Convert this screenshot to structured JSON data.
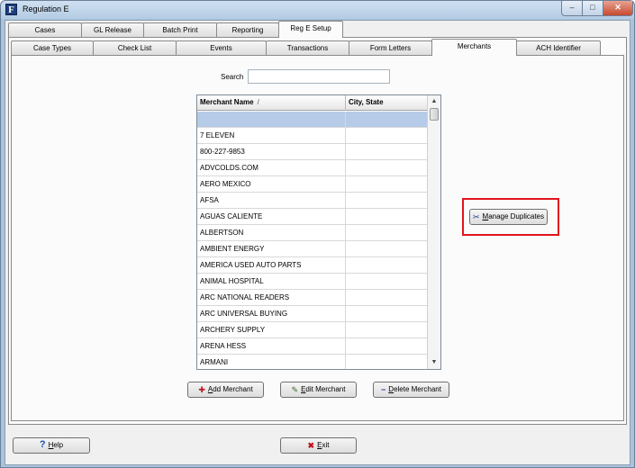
{
  "window": {
    "title": "Regulation E",
    "app_icon_glyph": "F",
    "controls": {
      "minimize": "–",
      "maximize": "□",
      "close": "✕"
    }
  },
  "main_tabs": [
    {
      "label": "Cases",
      "active": false
    },
    {
      "label": "GL Release",
      "active": false
    },
    {
      "label": "Batch Print",
      "active": false
    },
    {
      "label": "Reporting",
      "active": false
    },
    {
      "label": "Reg E Setup",
      "active": true
    }
  ],
  "sub_tabs": [
    {
      "label": "Case Types",
      "active": false
    },
    {
      "label": "Check List",
      "active": false
    },
    {
      "label": "Events",
      "active": false
    },
    {
      "label": "Transactions",
      "active": false
    },
    {
      "label": "Form Letters",
      "active": false
    },
    {
      "label": "Merchants",
      "active": true
    },
    {
      "label": "ACH Identifier",
      "active": false
    }
  ],
  "search": {
    "label": "Search",
    "value": ""
  },
  "grid": {
    "columns": [
      "Merchant Name",
      "City, State"
    ],
    "sort_indicator": "/",
    "rows": [
      {
        "name": "",
        "city": "",
        "selected": true
      },
      {
        "name": "7 ELEVEN",
        "city": ""
      },
      {
        "name": "800-227-9853",
        "city": ""
      },
      {
        "name": "ADVCOLDS.COM",
        "city": ""
      },
      {
        "name": "AERO MEXICO",
        "city": ""
      },
      {
        "name": "AFSA",
        "city": ""
      },
      {
        "name": "AGUAS CALIENTE",
        "city": ""
      },
      {
        "name": "ALBERTSON",
        "city": ""
      },
      {
        "name": "AMBIENT ENERGY",
        "city": ""
      },
      {
        "name": "AMERICA USED AUTO PARTS",
        "city": ""
      },
      {
        "name": "ANIMAL HOSPITAL",
        "city": ""
      },
      {
        "name": "ARC NATIONAL READERS",
        "city": ""
      },
      {
        "name": "ARC UNIVERSAL BUYING",
        "city": ""
      },
      {
        "name": "ARCHERY SUPPLY",
        "city": ""
      },
      {
        "name": "ARENA HESS",
        "city": ""
      },
      {
        "name": "ARMANI",
        "city": ""
      }
    ]
  },
  "buttons": {
    "manage_duplicates": {
      "mnemonic": "M",
      "rest": "anage Duplicates",
      "icon": "✂"
    },
    "add_merchant": {
      "mnemonic": "A",
      "rest": "dd Merchant",
      "icon": "✚"
    },
    "edit_merchant": {
      "mnemonic": "E",
      "rest": "dit Merchant",
      "icon": "✎"
    },
    "delete_merchant": {
      "mnemonic": "D",
      "rest": "elete Merchant",
      "icon": "−"
    },
    "help": {
      "mnemonic": "H",
      "rest": "elp",
      "icon": "?"
    },
    "exit": {
      "mnemonic": "E",
      "rest": "xit",
      "icon": "✖"
    }
  },
  "colors": {
    "highlight_box": "#e0141e",
    "selected_row": "#b6cbe8",
    "exit_icon": "#c0141e",
    "help_icon": "#1a56b0"
  }
}
